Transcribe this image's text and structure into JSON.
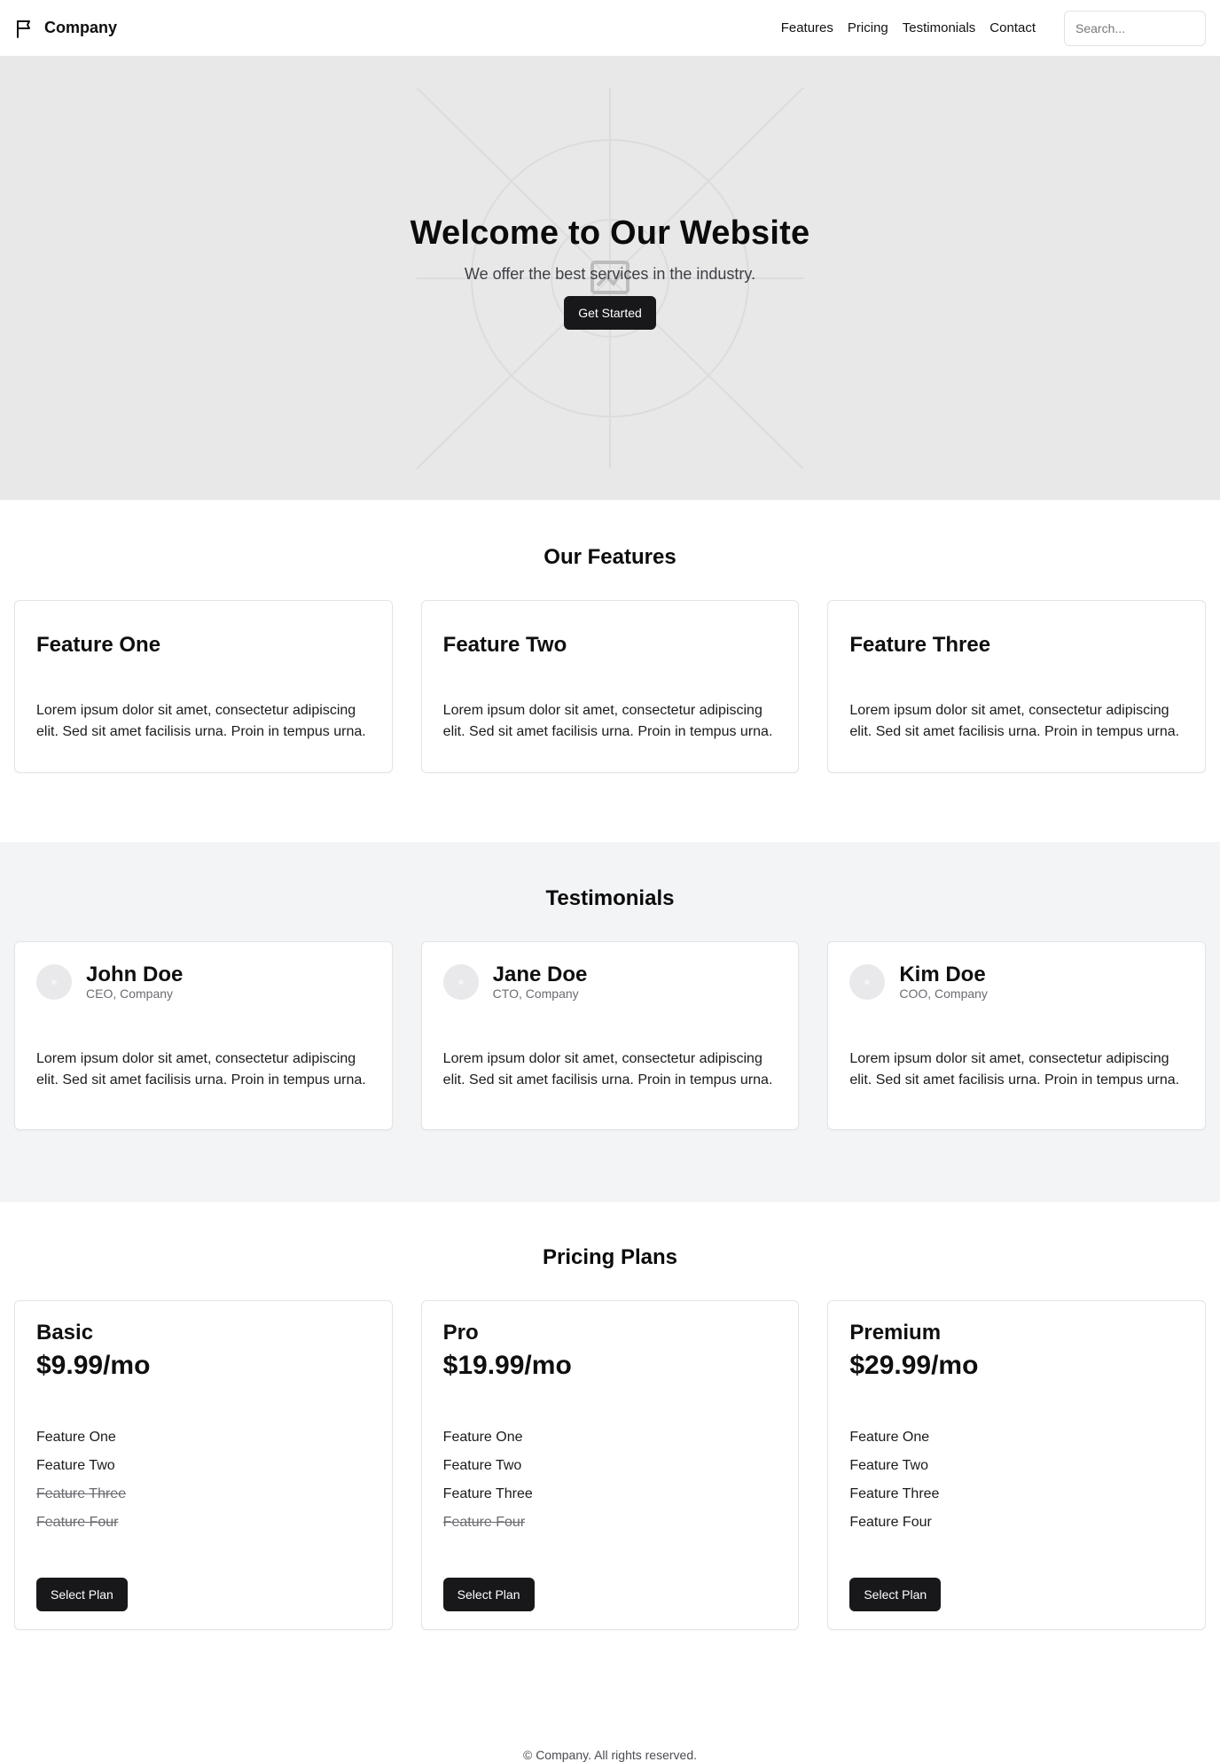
{
  "header": {
    "brand": "Company",
    "nav": [
      "Features",
      "Pricing",
      "Testimonials",
      "Contact"
    ],
    "search_placeholder": "Search..."
  },
  "hero": {
    "title": "Welcome to Our Website",
    "subtitle": "We offer the best services in the industry.",
    "cta": "Get Started"
  },
  "features": {
    "title": "Our Features",
    "items": [
      {
        "title": "Feature One",
        "text": "Lorem ipsum dolor sit amet, consectetur adipiscing elit. Sed sit amet facilisis urna. Proin in tempus urna."
      },
      {
        "title": "Feature Two",
        "text": "Lorem ipsum dolor sit amet, consectetur adipiscing elit. Sed sit amet facilisis urna. Proin in tempus urna."
      },
      {
        "title": "Feature Three",
        "text": "Lorem ipsum dolor sit amet, consectetur adipiscing elit. Sed sit amet facilisis urna. Proin in tempus urna."
      }
    ]
  },
  "testimonials": {
    "title": "Testimonials",
    "items": [
      {
        "name": "John Doe",
        "role": "CEO, Company",
        "text": "Lorem ipsum dolor sit amet, consectetur adipiscing elit. Sed sit amet facilisis urna. Proin in tempus urna."
      },
      {
        "name": "Jane Doe",
        "role": "CTO, Company",
        "text": "Lorem ipsum dolor sit amet, consectetur adipiscing elit. Sed sit amet facilisis urna. Proin in tempus urna."
      },
      {
        "name": "Kim Doe",
        "role": "COO, Company",
        "text": "Lorem ipsum dolor sit amet, consectetur adipiscing elit. Sed sit amet facilisis urna. Proin in tempus urna."
      }
    ]
  },
  "pricing": {
    "title": "Pricing Plans",
    "plans": [
      {
        "name": "Basic",
        "price": "$9.99/mo",
        "features": [
          "Feature One",
          "Feature Two",
          "Feature Three",
          "Feature Four"
        ],
        "included": [
          true,
          true,
          false,
          false
        ],
        "button": "Select Plan"
      },
      {
        "name": "Pro",
        "price": "$19.99/mo",
        "features": [
          "Feature One",
          "Feature Two",
          "Feature Three",
          "Feature Four"
        ],
        "included": [
          true,
          true,
          true,
          false
        ],
        "button": "Select Plan"
      },
      {
        "name": "Premium",
        "price": "$29.99/mo",
        "features": [
          "Feature One",
          "Feature Two",
          "Feature Three",
          "Feature Four"
        ],
        "included": [
          true,
          true,
          true,
          true
        ],
        "button": "Select Plan"
      }
    ]
  },
  "footer": {
    "text": "© Company. All rights reserved."
  },
  "colors": {
    "primary_button": "#18181b",
    "hero_bg": "#e8e8e8",
    "testimonials_bg": "#f3f4f6"
  }
}
